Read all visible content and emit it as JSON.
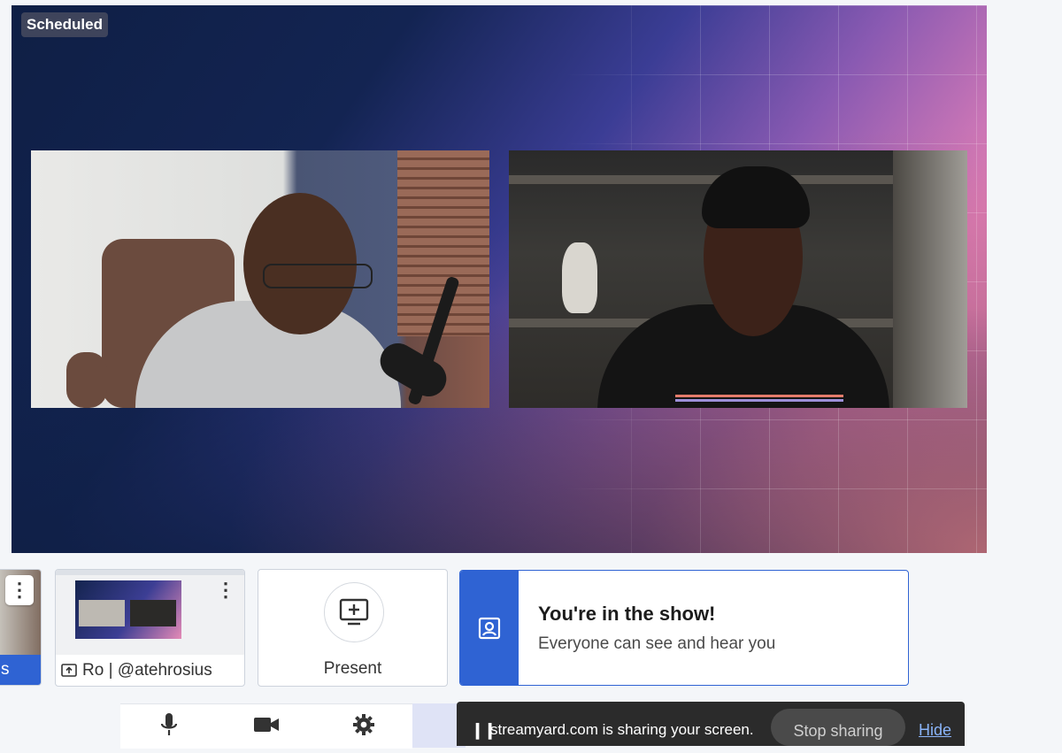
{
  "stage": {
    "status_badge": "Scheduled"
  },
  "tiles": {
    "partial_label": "s",
    "screen_caption": "Ro | @atehrosius",
    "present_label": "Present"
  },
  "show_card": {
    "title": "You're in the show!",
    "subtitle": "Everyone can see and hear you"
  },
  "controls": {
    "icons": [
      "microphone-icon",
      "camera-icon",
      "gear-icon"
    ]
  },
  "share_bar": {
    "message": "streamyard.com is sharing your screen.",
    "stop_label": "Stop sharing",
    "hide_label": "Hide"
  },
  "colors": {
    "brand_blue": "#2f63d3",
    "stage_dark": "#0f1f45",
    "stage_pink": "#e17fb7"
  }
}
